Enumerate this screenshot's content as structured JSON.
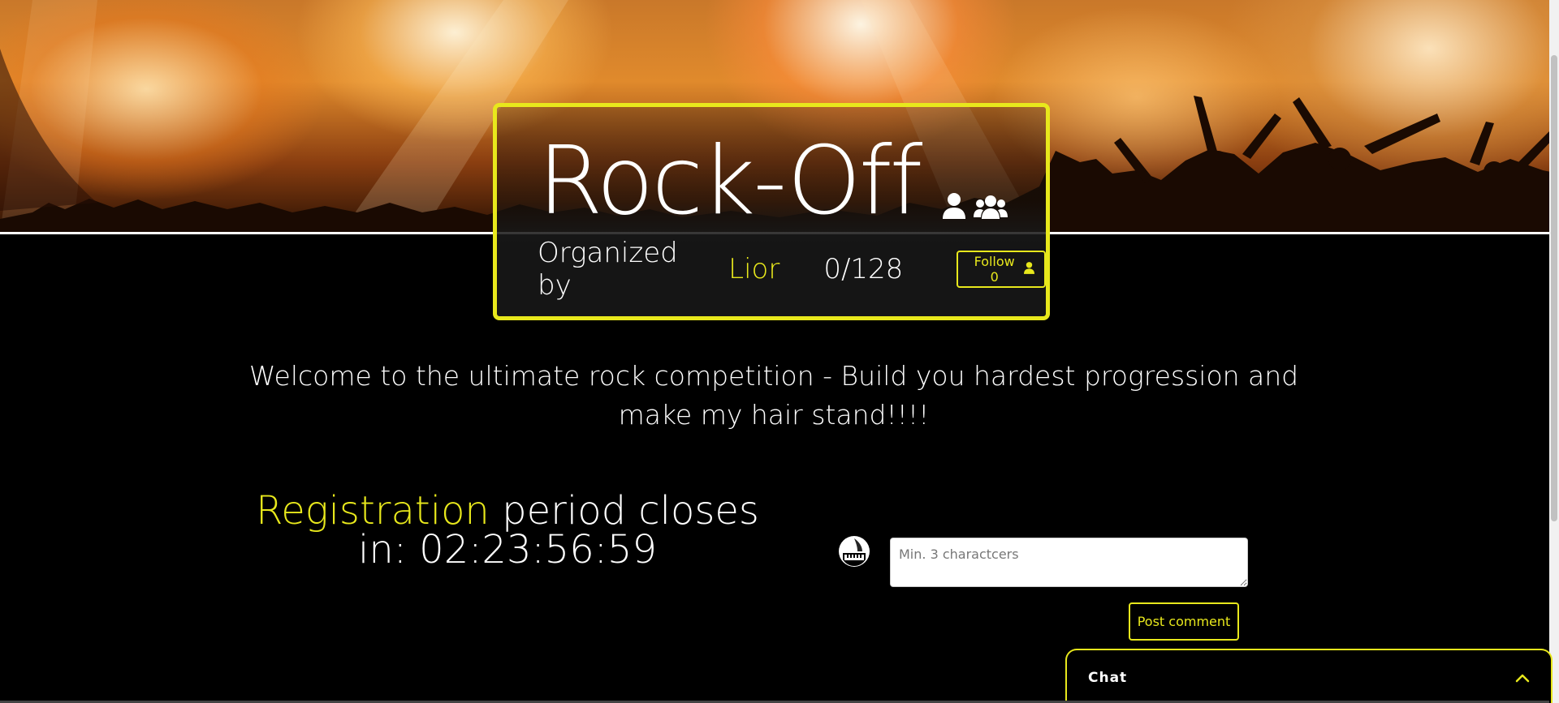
{
  "event": {
    "title": "Rock-Off",
    "organized_by_label": "Organized by",
    "organizer_name": "Lior",
    "participants": "0/128",
    "follow_label": "Follow 0"
  },
  "description": "Welcome to the ultimate rock competition - Build you hardest progression and make my hair stand!!!!",
  "countdown": {
    "accent_word": "Registration",
    "text": "period closes in: 02:23:56:59"
  },
  "comment": {
    "placeholder": "Min. 3 charactcers",
    "post_label": "Post comment"
  },
  "chat": {
    "label": "Chat"
  },
  "icons": {
    "user": "user-icon",
    "group": "users-icon",
    "avatar": "piano-avatar-icon",
    "chevron": "chevron-up-icon"
  },
  "colors": {
    "accent": "#e8e81c",
    "background": "#000000"
  }
}
